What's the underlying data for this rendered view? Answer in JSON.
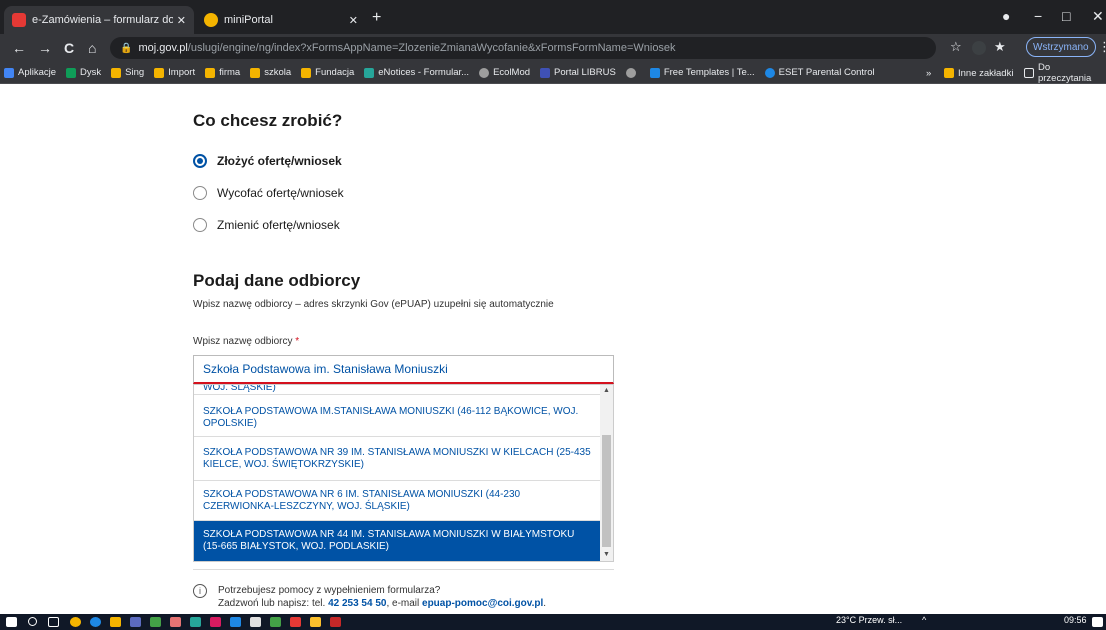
{
  "browser": {
    "tabs": [
      {
        "title": "e-Zamówienia – formularz do zło",
        "favicon_color": "#e53935"
      },
      {
        "title": "miniPortal",
        "favicon_color": "#f4b400"
      }
    ],
    "new_tab": "+",
    "window_controls": {
      "minimize": "−",
      "maximize": "□",
      "close": "✕"
    },
    "nav": {
      "back": "←",
      "forward": "→",
      "reload": "C",
      "home": "⌂"
    },
    "url_host": "moj.gov.pl",
    "url_path": "/uslugi/engine/ng/index?xFormsAppName=ZlozenieZmianaWycofanie&xFormsFormName=Wniosek",
    "star": "☆",
    "extensions": "★",
    "paused_label": "Wstrzymano",
    "menu": "⋮",
    "bookmarks": [
      {
        "label": "Aplikacje",
        "color": "#4285f4"
      },
      {
        "label": "Dysk",
        "color": "#0f9d58"
      },
      {
        "label": "Sing",
        "color": "#f4b400"
      },
      {
        "label": "Import",
        "color": "#f4b400"
      },
      {
        "label": "firma",
        "color": "#f4b400"
      },
      {
        "label": "szkola",
        "color": "#f4b400"
      },
      {
        "label": "Fundacja",
        "color": "#f4b400"
      },
      {
        "label": "eNotices - Formular...",
        "color": "#26a69a"
      },
      {
        "label": "EcolMod",
        "color": "#9e9e9e"
      },
      {
        "label": "Portal LIBRUS",
        "color": "#3f51b5"
      },
      {
        "label": "",
        "color": "#9e9e9e"
      },
      {
        "label": "Free Templates | Te...",
        "color": "#1e88e5"
      },
      {
        "label": "ESET Parental Control",
        "color": "#1e88e5"
      }
    ],
    "bookmarks_more": "»",
    "other_bookmarks": "Inne zakładki",
    "reading_list": "Do przeczytania"
  },
  "form": {
    "section1_title": "Co chcesz zrobić?",
    "radios": [
      {
        "label": "Złożyć ofertę/wniosek",
        "checked": true
      },
      {
        "label": "Wycofać ofertę/wniosek",
        "checked": false
      },
      {
        "label": "Zmienić ofertę/wniosek",
        "checked": false
      }
    ],
    "section2_title": "Podaj dane odbiorcy",
    "section2_desc": "Wpisz nazwę odbiorcy – adres skrzynki Gov (ePUAP) uzupełni się automatycznie",
    "field_label": "Wpisz nazwę odbiorcy",
    "required_mark": "*",
    "input_value": "Szkoła Podstawowa im. Stanisława Moniuszki",
    "suggestions": [
      {
        "text": "WOJ. ŚLĄSKIE)",
        "selected": false
      },
      {
        "text": "SZKOŁA PODSTAWOWA IM.STANISŁAWA MONIUSZKI (46-112 BĄKOWICE, WOJ. OPOLSKIE)",
        "selected": false
      },
      {
        "text": "SZKOŁA PODSTAWOWA NR 39 IM. STANISŁAWA MONIUSZKI W KIELCACH (25-435 KIELCE, WOJ. ŚWIĘTOKRZYSKIE)",
        "selected": false
      },
      {
        "text": "SZKOŁA PODSTAWOWA NR 6 IM. STANISŁAWA MONIUSZKI (44-230 CZERWIONKA-LESZCZYNY, WOJ. ŚLĄSKIE)",
        "selected": false
      },
      {
        "text": "SZKOŁA PODSTAWOWA NR 44 IM. STANISŁAWA MONIUSZKI W BIAŁYMSTOKU (15-665 BIAŁYSTOK, WOJ. PODLASKIE)",
        "selected": true
      }
    ],
    "help_icon": "i",
    "help_line1": "Potrzebujesz pomocy z wypełnieniem formularza?",
    "help_line2_prefix": "Zadzwoń lub napisz: tel. ",
    "help_phone": "42 253 54 50",
    "help_line2_mid": ", e-mail ",
    "help_email": "epuap-pomoc@coi.gov.pl",
    "help_line2_suffix": "."
  },
  "taskbar": {
    "icons": [
      "windows-start",
      "search",
      "task-view",
      "chrome",
      "edge",
      "explorer",
      "app",
      "app",
      "app",
      "app",
      "app",
      "app",
      "app",
      "app",
      "app",
      "app",
      "app"
    ],
    "weather": "23°C  Przew. sł...",
    "tray_arrow": "^",
    "time": "09:56"
  }
}
